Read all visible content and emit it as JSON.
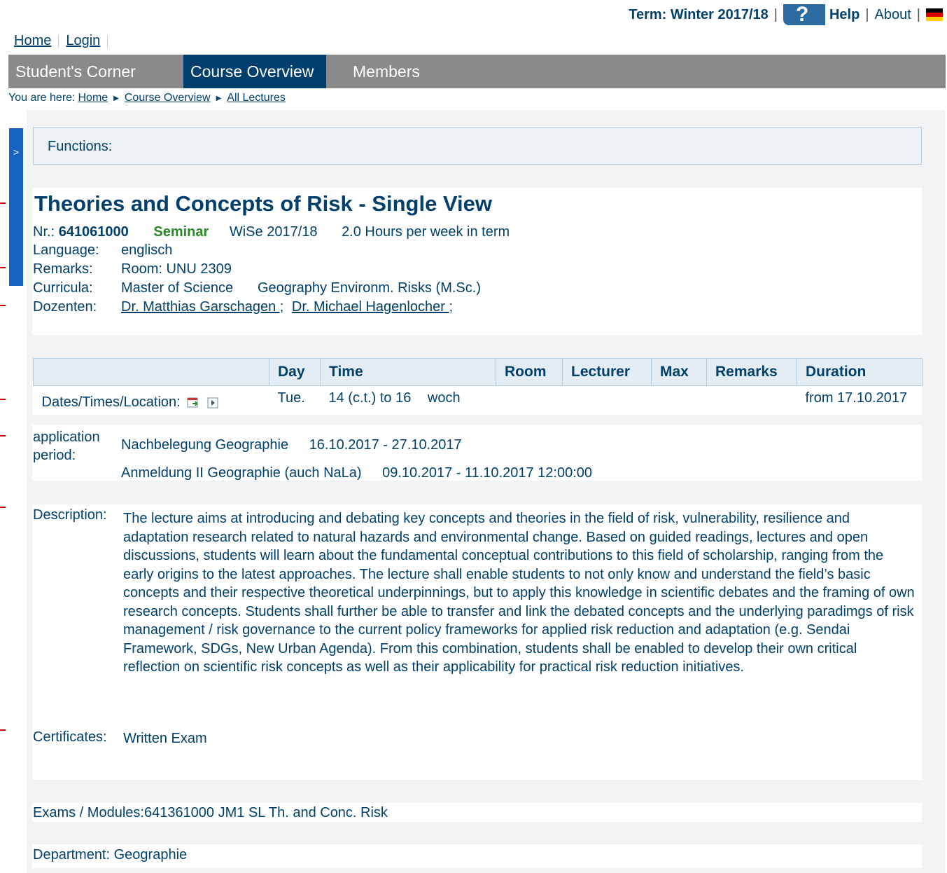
{
  "header": {
    "term": "Term: Winter 2017/18",
    "help": "Help",
    "about": "About"
  },
  "toplinks": {
    "home": "Home",
    "login": "Login"
  },
  "menu": {
    "items": [
      "Student's Corner",
      "Course Overview",
      "Members"
    ]
  },
  "breadcrumb": {
    "prefix": "You are here:",
    "home": "Home",
    "course_overview": "Course Overview",
    "all_lectures": "All Lectures"
  },
  "sidetab": {
    "label": ">"
  },
  "functions": {
    "label": "Functions:"
  },
  "course": {
    "title": "Theories and Concepts of Risk - Single View",
    "nr_label": "Nr.:",
    "nr": "641061000",
    "type": "Seminar",
    "semester": "WiSe 2017/18",
    "hours": "2.0 Hours per week in term",
    "language_label": "Language:",
    "language": "englisch",
    "remarks_label": "Remarks:",
    "remarks": "Room: UNU 2309",
    "curricula_label": "Curricula:",
    "curricula_1": "Master of Science",
    "curricula_2": "Geography Environm. Risks (M.Sc.)",
    "dozenten_label": "Dozenten:",
    "lecturer_1": "Dr. Matthias Garschagen ;",
    "lecturer_2": "Dr. Michael Hagenlocher ;"
  },
  "dates": {
    "headers": [
      "",
      "Day",
      "Time",
      "Room",
      "Lecturer",
      "Max",
      "Remarks",
      "Duration"
    ],
    "row_label": "Dates/Times/Location:",
    "day": "Tue.",
    "time": "14 (c.t.) to 16",
    "rhythm": "woch",
    "duration": "from 17.10.2017"
  },
  "application": {
    "label_1": "application",
    "label_2": "period:",
    "entry_1_name": "Nachbelegung Geographie",
    "entry_1_period": "16.10.2017 - 27.10.2017",
    "entry_2_name": "Anmeldung II Geographie (auch NaLa)",
    "entry_2_period": "09.10.2017 - 11.10.2017 12:00:00"
  },
  "description": {
    "label": "Description:",
    "text": "The lecture aims at introducing and debating key concepts and theories in the field of risk, vulnerability, resilience and adaptation research related to natural hazards and environmental change. Based on guided readings, lectures and open discussions, students will learn about the fundamental conceptual contributions to this field of scholarship, ranging from the early origins to the latest approaches. The lecture shall enable students to not only know and understand the field’s basic concepts and their respective theoretical underpinnings, but to apply this knowledge in scientific debates and the framing of own research concepts. Students shall further be able to transfer and link the debated concepts and the underlying paradimgs of risk management / risk governance to the current policy frameworks for applied risk reduction and adaptation (e.g. Sendai Framework, SDGs, New Urban Agenda). From this combination, students shall be enabled to develop their own critical reflection on scientific risk concepts as well as their applicability for practical risk reduction initiatives."
  },
  "certificates": {
    "label": "Certificates:",
    "value": "Written Exam"
  },
  "exams": {
    "text": "Exams / Modules:641361000 JM1 SL Th. and Conc. Risk"
  },
  "department": {
    "label": "Department:",
    "value": "Geographie"
  },
  "colors": {
    "primary": "#00406b",
    "menubar": "#8a8a8a",
    "menu_active": "#003e6e",
    "seminar": "#2a8a2a",
    "sidetab": "#1565c0"
  }
}
